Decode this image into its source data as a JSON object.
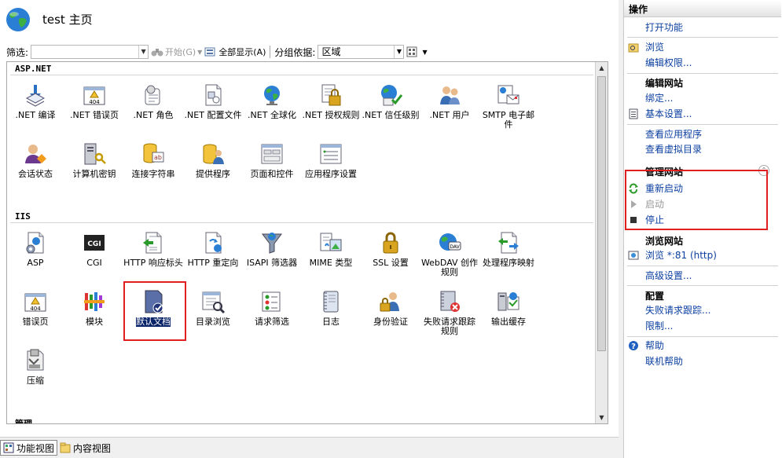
{
  "header": {
    "title": "test 主页"
  },
  "filterbar": {
    "filter_label": "筛选:",
    "start_label": "开始(G)",
    "show_all_label": "全部显示(A)",
    "group_by_label": "分组依据:",
    "group_by_value": "区域"
  },
  "sections": [
    {
      "label": "ASP.NET"
    },
    {
      "label": "IIS"
    },
    {
      "label": "管理"
    }
  ],
  "aspnet_features": [
    {
      "label": ".NET 编译",
      "icon": "net-compile-icon"
    },
    {
      "label": ".NET 错误页",
      "icon": "error-page-404-icon"
    },
    {
      "label": ".NET 角色",
      "icon": "net-roles-icon"
    },
    {
      "label": ".NET 配置文件",
      "icon": "net-profile-icon"
    },
    {
      "label": ".NET 全球化",
      "icon": "globe-icon"
    },
    {
      "label": ".NET 授权规则",
      "icon": "lock-document-icon"
    },
    {
      "label": ".NET 信任级别",
      "icon": "trust-level-icon"
    },
    {
      "label": ".NET 用户",
      "icon": "users-icon"
    },
    {
      "label": "SMTP 电子邮件",
      "icon": "smtp-email-icon"
    },
    {
      "label": "会话状态",
      "icon": "session-state-icon"
    },
    {
      "label": "计算机密钥",
      "icon": "machine-key-icon"
    },
    {
      "label": "连接字符串",
      "icon": "connection-string-icon"
    },
    {
      "label": "提供程序",
      "icon": "providers-icon"
    },
    {
      "label": "页面和控件",
      "icon": "pages-controls-icon"
    },
    {
      "label": "应用程序设置",
      "icon": "app-settings-icon"
    }
  ],
  "iis_features": [
    {
      "label": "ASP",
      "icon": "asp-icon"
    },
    {
      "label": "CGI",
      "icon": "cgi-icon"
    },
    {
      "label": "HTTP 响应标头",
      "icon": "http-response-headers-icon"
    },
    {
      "label": "HTTP 重定向",
      "icon": "http-redirect-icon"
    },
    {
      "label": "ISAPI 筛选器",
      "icon": "isapi-filter-icon"
    },
    {
      "label": "MIME 类型",
      "icon": "mime-types-icon"
    },
    {
      "label": "SSL 设置",
      "icon": "ssl-lock-icon"
    },
    {
      "label": "WebDAV 创作规则",
      "icon": "webdav-icon"
    },
    {
      "label": "处理程序映射",
      "icon": "handler-mappings-icon"
    },
    {
      "label": "错误页",
      "icon": "error-page-404-icon"
    },
    {
      "label": "模块",
      "icon": "modules-icon"
    },
    {
      "label": "默认文档",
      "icon": "default-document-icon"
    },
    {
      "label": "目录浏览",
      "icon": "directory-browsing-icon"
    },
    {
      "label": "请求筛选",
      "icon": "request-filtering-icon"
    },
    {
      "label": "日志",
      "icon": "logging-icon"
    },
    {
      "label": "身份验证",
      "icon": "authentication-icon"
    },
    {
      "label": "失败请求跟踪规则",
      "icon": "failed-request-tracing-icon"
    },
    {
      "label": "输出缓存",
      "icon": "output-caching-icon"
    },
    {
      "label": "压缩",
      "icon": "compression-icon"
    }
  ],
  "bottom_tabs": [
    {
      "label": "功能视图"
    },
    {
      "label": "内容视图"
    }
  ],
  "actions": {
    "header": "操作",
    "open_feature": "打开功能",
    "browse": "浏览",
    "edit_permissions": "编辑权限...",
    "edit_site_title": "编辑网站",
    "bindings": "绑定...",
    "basic_settings": "基本设置...",
    "view_applications": "查看应用程序",
    "view_virtual_dirs": "查看虚拟目录",
    "manage_site_title": "管理网站",
    "restart": "重新启动",
    "start": "启动",
    "stop": "停止",
    "browse_site_title": "浏览网站",
    "browse_port": "浏览 *:81 (http)",
    "advanced_settings": "高级设置...",
    "configure_title": "配置",
    "failed_request_tracing": "失败请求跟踪...",
    "limits": "限制...",
    "help": "帮助",
    "online_help": "联机帮助"
  }
}
